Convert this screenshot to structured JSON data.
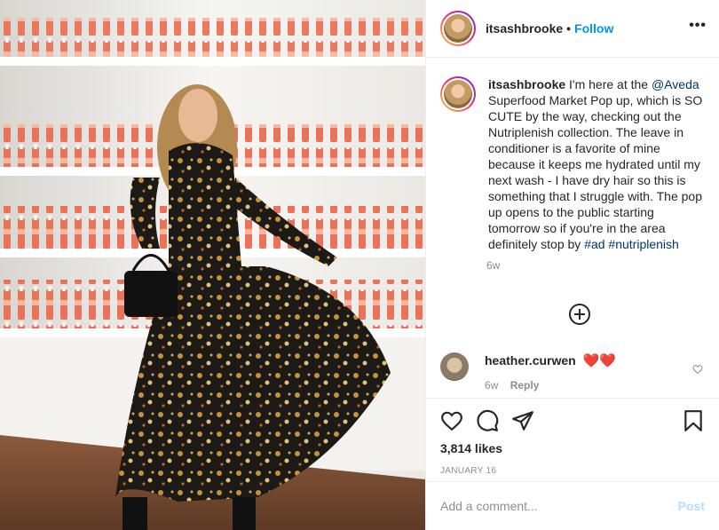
{
  "header": {
    "username": "itsashbrooke",
    "separator": "•",
    "follow_label": "Follow",
    "more_label": "•••"
  },
  "caption": {
    "username": "itsashbrooke",
    "text_1": " I'm here at the ",
    "mention": "@Aveda",
    "text_2": " Superfood Market Pop up, which is SO CUTE by the way, checking out the Nutriplenish collection. The leave in conditioner is a favorite of mine because it keeps me hydrated until my next wash - I have dry hair so this is something that I struggle with. The pop up opens to the public starting tomorrow so if you're in the area definitely stop by ",
    "hashtag_1": "#ad",
    "hashtag_2": "#nutriplenish",
    "time": "6w"
  },
  "comment": {
    "username": "heather.curwen",
    "text": "❤️❤️",
    "time": "6w",
    "reply_label": "Reply"
  },
  "actions": {
    "icons": [
      "heart-icon",
      "comment-icon",
      "share-icon",
      "bookmark-icon"
    ]
  },
  "likes": "3,814 likes",
  "date": "JANUARY 16",
  "add_comment": {
    "placeholder": "Add a comment...",
    "post_label": "Post"
  },
  "colors": {
    "link_blue": "#0095f6",
    "mention_blue": "#00376b",
    "heart_red": "#ed4956",
    "muted_gray": "#8e8e8e",
    "post_disabled": "#b2dffc",
    "product_orange": "#e9735a"
  }
}
